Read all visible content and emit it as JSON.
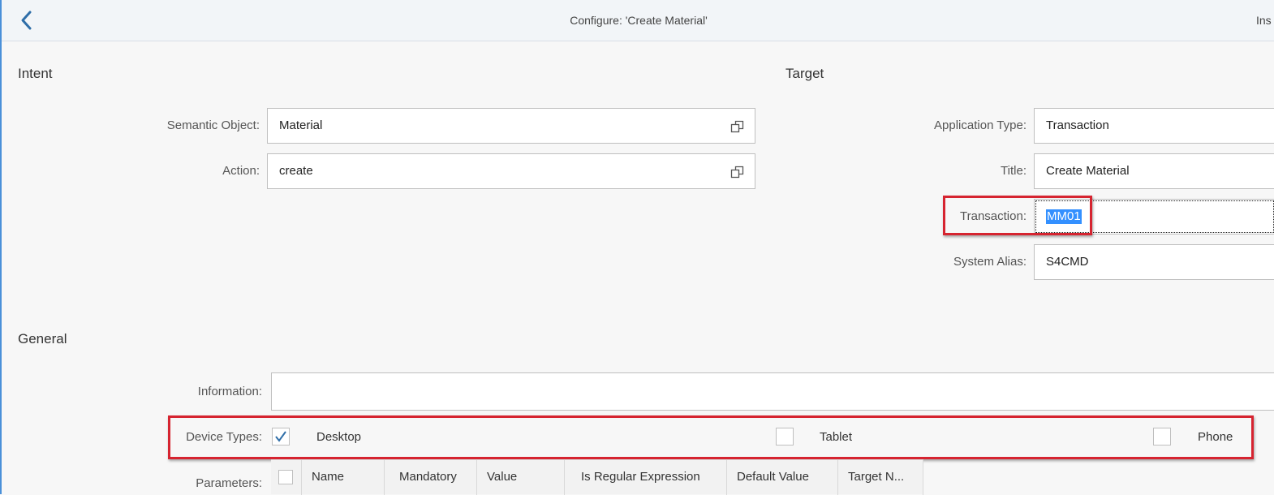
{
  "header": {
    "title": "Configure: 'Create Material'",
    "right_label": "Ins"
  },
  "intent": {
    "section_title": "Intent",
    "semantic_object_label": "Semantic Object:",
    "semantic_object_value": "Material",
    "action_label": "Action:",
    "action_value": "create"
  },
  "target": {
    "section_title": "Target",
    "application_type_label": "Application Type:",
    "application_type_value": "Transaction",
    "title_label": "Title:",
    "title_value": "Create Material",
    "transaction_label": "Transaction:",
    "transaction_value": "MM01",
    "system_alias_label": "System Alias:",
    "system_alias_value": "S4CMD"
  },
  "general": {
    "section_title": "General",
    "information_label": "Information:",
    "information_value": "",
    "device_types_label": "Device Types:",
    "devices": [
      {
        "label": "Desktop",
        "checked": true
      },
      {
        "label": "Tablet",
        "checked": false
      },
      {
        "label": "Phone",
        "checked": false
      }
    ],
    "parameters_label": "Parameters:",
    "parameter_columns": [
      "Name",
      "Mandatory",
      "Value",
      "Is Regular Expression",
      "Default Value",
      "Target N..."
    ]
  },
  "icons": {
    "back": "chevron-left-icon",
    "value_help": "value-help-icon",
    "checkmark": "checkmark-icon"
  },
  "colors": {
    "accent": "#2f6ea8",
    "highlight_border": "#d62430",
    "selection": "#3390ff"
  }
}
